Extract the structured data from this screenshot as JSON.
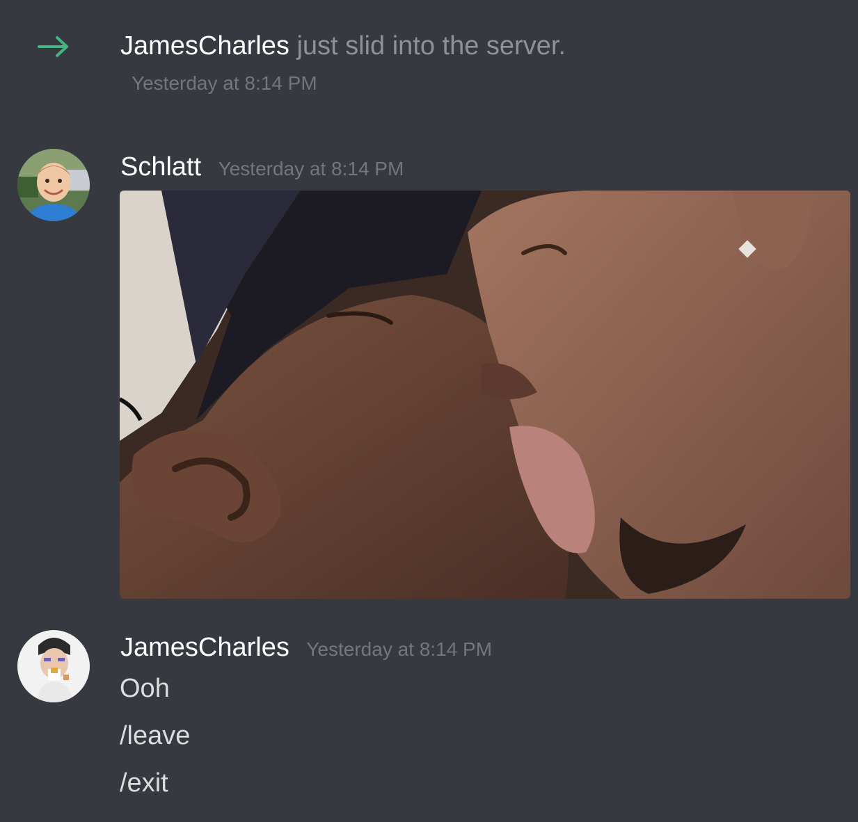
{
  "join_message": {
    "icon": "arrow-right-icon",
    "accent_color": "#43b581",
    "username": "JamesCharles",
    "text": "just slid into the server.",
    "timestamp": "Yesterday at 8:14 PM"
  },
  "messages": [
    {
      "username": "Schlatt",
      "timestamp": "Yesterday at 8:14 PM",
      "avatar": "avatar-child-photo",
      "attachment": "gif-image"
    },
    {
      "username": "JamesCharles",
      "timestamp": "Yesterday at 8:14 PM",
      "avatar": "avatar-makeup-portrait",
      "lines": [
        "Ooh",
        "/leave",
        "/exit"
      ]
    }
  ],
  "colors": {
    "background": "#36393f",
    "username": "#ffffff",
    "timestamp": "#72767d",
    "message_text": "#dcddde"
  }
}
